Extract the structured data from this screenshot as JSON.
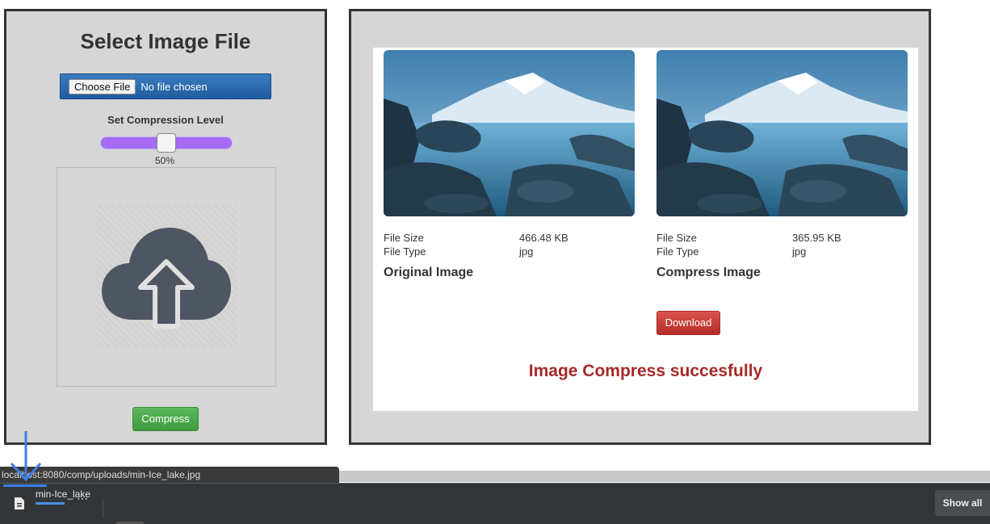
{
  "left": {
    "title": "Select Image File",
    "file_input": {
      "button_label": "Choose File",
      "status": "No file chosen"
    },
    "compression": {
      "label": "Set Compression Level",
      "value_text": "50%",
      "value": 0.5
    },
    "upload_icon": "cloud-upload-icon",
    "compress_label": "Compress"
  },
  "right": {
    "original": {
      "file_size_label": "File Size",
      "file_size": "466.48 KB",
      "file_type_label": "File Type",
      "file_type": "jpg",
      "title": "Original Image"
    },
    "compressed": {
      "file_size_label": "File Size",
      "file_size": "365.95 KB",
      "file_type_label": "File Type",
      "file_type": "jpg",
      "title": "Compress Image"
    },
    "download_label": "Download",
    "success_message": "Image Compress succesfully"
  },
  "browser": {
    "status_url": "localhost:8080/comp/uploads/min-Ice_lake.jpg",
    "download_item": {
      "name": "min-Ice_lake",
      "progress": 0.45
    },
    "more_label": "⋯",
    "show_all_label": "Show all"
  },
  "colors": {
    "panel_bg": "#d6d6d6",
    "slider": "#a66cf5",
    "compress_button": "#5cb85c",
    "download_button": "#d9534f",
    "success_text": "#a52a2a",
    "file_button": "#2a6aad"
  }
}
